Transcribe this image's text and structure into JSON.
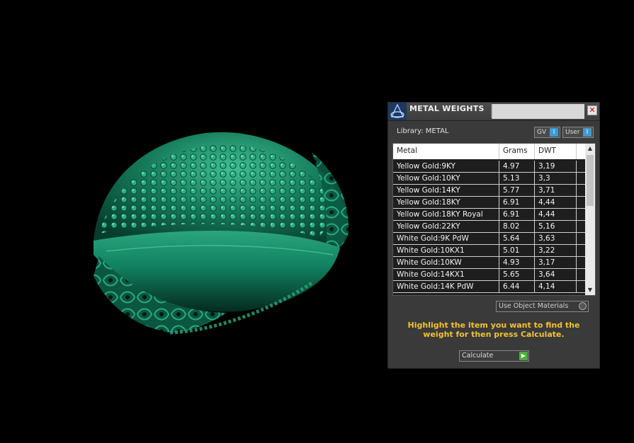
{
  "panel": {
    "title": "METAL WEIGHTS",
    "close_icon": "close-icon",
    "logo_icon": "app-logo-icon",
    "library_label": "Library: METAL",
    "toggle_gv": "GV",
    "toggle_user": "User",
    "toggle_knob": "I",
    "columns": [
      "Metal",
      "Grams",
      "DWT"
    ],
    "rows": [
      {
        "metal": "Yellow Gold:9KY",
        "grams": "4.97",
        "dwt": "3,19"
      },
      {
        "metal": "Yellow Gold:10KY",
        "grams": "5.13",
        "dwt": "3,3"
      },
      {
        "metal": "Yellow Gold:14KY",
        "grams": "5.77",
        "dwt": "3,71"
      },
      {
        "metal": "Yellow Gold:18KY",
        "grams": "6.91",
        "dwt": "4,44"
      },
      {
        "metal": "Yellow Gold:18KY Royal",
        "grams": "6.91",
        "dwt": "4,44"
      },
      {
        "metal": "Yellow Gold:22KY",
        "grams": "8.02",
        "dwt": "5,16"
      },
      {
        "metal": "White Gold:9K PdW",
        "grams": "5.64",
        "dwt": "3,63"
      },
      {
        "metal": "White Gold:10KX1",
        "grams": "5.01",
        "dwt": "3,22"
      },
      {
        "metal": "White Gold:10KW",
        "grams": "4.93",
        "dwt": "3,17"
      },
      {
        "metal": "White Gold:14KX1",
        "grams": "5.65",
        "dwt": "3,64"
      },
      {
        "metal": "White Gold:14K PdW",
        "grams": "6.44",
        "dwt": "4,14"
      }
    ],
    "use_object_materials": "Use Object Materials",
    "instruction": "Highlight the item you want to find the weight for then press Calculate.",
    "calculate_label": "Calculate",
    "calculate_icon": "play-arrow-icon",
    "colors": {
      "accent_blue": "#3f9bd1",
      "instruction_yellow": "#f2c230",
      "go_green": "#4caf3a",
      "ring_green": "#1f8f6c"
    }
  }
}
